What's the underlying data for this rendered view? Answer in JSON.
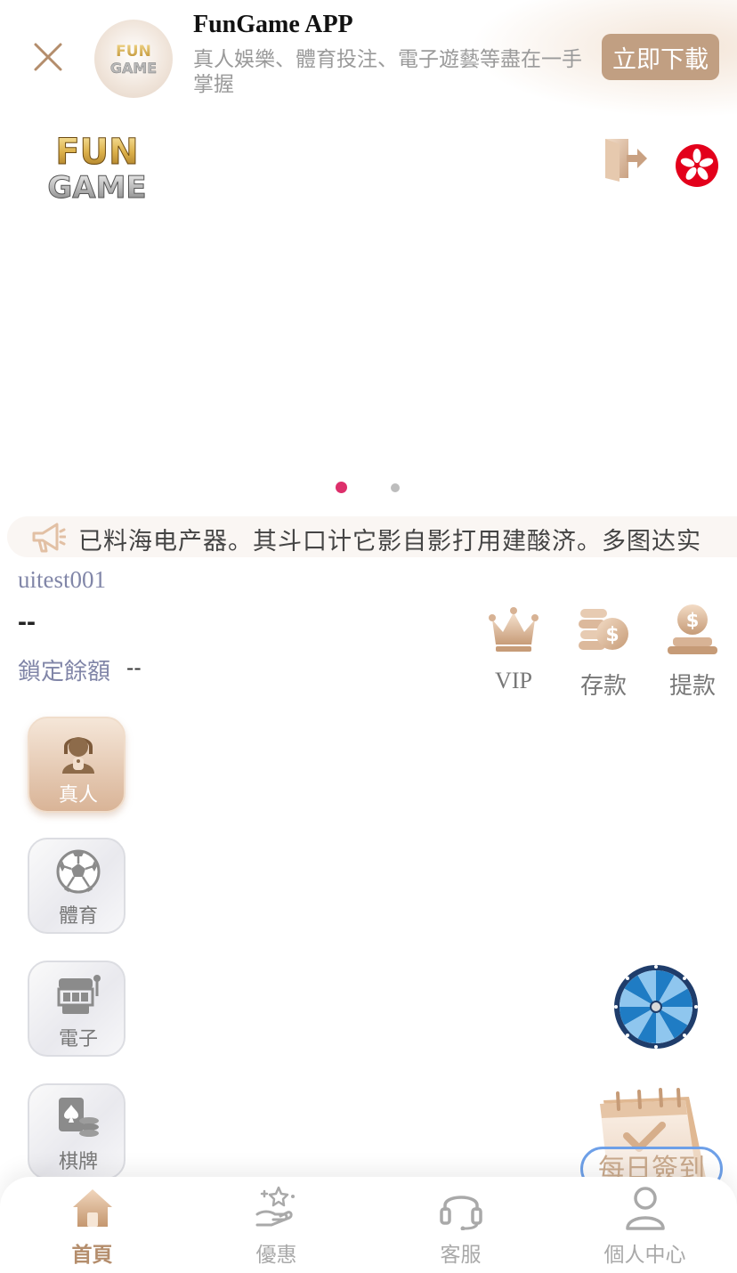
{
  "app_banner": {
    "title": "FunGame APP",
    "description": "真人娛樂、體育投注、電子遊藝等盡在一手掌握",
    "download_label": "立即下載",
    "icon_logo_line1": "FUN",
    "icon_logo_line2": "GAME"
  },
  "header": {
    "logo_line1": "FUN",
    "logo_line2": "GAME"
  },
  "carousel": {
    "slide_count": 2,
    "active_index": 0
  },
  "marquee": {
    "text": "已料海电产器。其斗口计它影自影打用建酸济。多图达实"
  },
  "account": {
    "username": "uitest001",
    "balance": "--",
    "locked_label": "鎖定餘額",
    "locked_value": "--"
  },
  "quick_actions": [
    {
      "label": "VIP",
      "icon": "crown-icon"
    },
    {
      "label": "存款",
      "icon": "deposit-coins-icon"
    },
    {
      "label": "提款",
      "icon": "withdraw-icon"
    }
  ],
  "categories": [
    {
      "label": "真人",
      "icon": "live-dealer-icon",
      "active": true
    },
    {
      "label": "體育",
      "icon": "soccer-ball-icon",
      "active": false
    },
    {
      "label": "電子",
      "icon": "slot-machine-icon",
      "active": false
    },
    {
      "label": "棋牌",
      "icon": "cards-chips-icon",
      "active": false
    }
  ],
  "widgets": {
    "checkin_label": "每日簽到"
  },
  "bottom_nav": [
    {
      "label": "首頁",
      "icon": "home-icon",
      "active": true
    },
    {
      "label": "優惠",
      "icon": "promotion-icon",
      "active": false
    },
    {
      "label": "客服",
      "icon": "headset-icon",
      "active": false
    },
    {
      "label": "個人中心",
      "icon": "user-icon",
      "active": false
    }
  ],
  "colors": {
    "accent": "#c19f82",
    "active_dot": "#dd2f6b",
    "muted_text": "#8186a8",
    "nav_active": "#b48d6c"
  }
}
